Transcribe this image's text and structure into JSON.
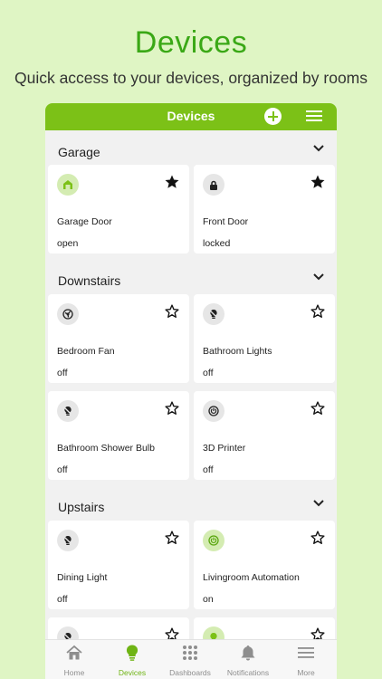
{
  "promo": {
    "title": "Devices",
    "subtitle": "Quick access to your devices, organized by rooms"
  },
  "appbar": {
    "title": "Devices",
    "add_icon": "plus-circle-icon",
    "menu_icon": "hamburger-menu-icon"
  },
  "sections": [
    {
      "title": "Garage",
      "devices": [
        {
          "name": "Garage Door",
          "status": "open",
          "icon": "garage-door-icon",
          "favorite": true,
          "active": true
        },
        {
          "name": "Front Door",
          "status": "locked",
          "icon": "lock-icon",
          "favorite": true,
          "active": false
        }
      ]
    },
    {
      "title": "Downstairs",
      "devices": [
        {
          "name": "Bedroom Fan",
          "status": "off",
          "icon": "fan-icon",
          "favorite": false,
          "active": false
        },
        {
          "name": "Bathroom Lights",
          "status": "off",
          "icon": "bulb-icon",
          "favorite": false,
          "active": false
        },
        {
          "name": "Bathroom Shower Bulb",
          "status": "off",
          "icon": "bulb-icon",
          "favorite": false,
          "active": false
        },
        {
          "name": "3D Printer",
          "status": "off",
          "icon": "power-icon",
          "favorite": false,
          "active": false
        }
      ]
    },
    {
      "title": "Upstairs",
      "devices": [
        {
          "name": "Dining Light",
          "status": "off",
          "icon": "bulb-icon",
          "favorite": false,
          "active": false
        },
        {
          "name": "Livingroom Automation",
          "status": "on",
          "icon": "power-icon",
          "favorite": false,
          "active": true
        },
        {
          "name": "",
          "status": "",
          "icon": "bulb-icon",
          "favorite": false,
          "active": false
        },
        {
          "name": "",
          "status": "",
          "icon": "bulb-icon",
          "favorite": false,
          "active": true
        }
      ]
    }
  ],
  "tabs": [
    {
      "label": "Home",
      "icon": "home-icon",
      "active": false
    },
    {
      "label": "Devices",
      "icon": "bulb-icon",
      "active": true
    },
    {
      "label": "Dashboards",
      "icon": "grid-icon",
      "active": false
    },
    {
      "label": "Notifications",
      "icon": "bell-icon",
      "active": false
    },
    {
      "label": "More",
      "icon": "hamburger-menu-icon",
      "active": false
    }
  ],
  "colors": {
    "brand_green": "#7cc117",
    "title_green": "#3aa816",
    "background": "#dff5c4",
    "active_tab": "#6fb414",
    "inactive_tab": "#8e8e8e"
  }
}
